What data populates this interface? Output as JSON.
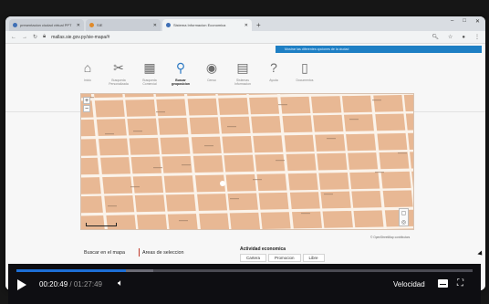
{
  "browser": {
    "tabs": [
      {
        "title": "presentacion ciudad virtual PPT"
      },
      {
        "title": "SIE"
      },
      {
        "title": "Sistema Informacion Economica"
      }
    ],
    "url": "mallas.sie.gov.py/sie-mapa/#"
  },
  "page": {
    "banner_text": "Mostrar las diferentes opciones de la ciudad"
  },
  "toolbar": {
    "items": [
      {
        "label": "Inicio",
        "icon": "home-icon",
        "active": false
      },
      {
        "label": "Busqueda Personalizada",
        "icon": "tools-icon",
        "active": false
      },
      {
        "label": "Busqueda Comercial",
        "icon": "store-icon",
        "active": false
      },
      {
        "label": "Buscar geoposicion",
        "icon": "locate-icon",
        "active": true
      },
      {
        "label": "Censo",
        "icon": "disc-icon",
        "active": false
      },
      {
        "label": "Sistemas Informacion",
        "icon": "calculator-icon",
        "active": false
      },
      {
        "label": "Ayuda",
        "icon": "help-icon",
        "active": false
      },
      {
        "label": "Documentos",
        "icon": "document-icon",
        "active": false
      }
    ]
  },
  "map": {
    "zoom_in": "+",
    "zoom_out": "−",
    "attribution": "© OpenStreetMap contributors"
  },
  "lower": {
    "search_prefix": "Buscar en el",
    "search_link": "mapa",
    "selection_link": "Areas de seleccion",
    "activity_title": "Actividad economica",
    "activity_tabs": [
      "Cartera",
      "Promocion",
      "Libre"
    ]
  },
  "player": {
    "current_time": "00:20:49",
    "duration": "01:27:49",
    "separator": "/",
    "speed_label": "Velocidad",
    "progress": 0.24
  },
  "colors": {
    "map_block": "#e8b894",
    "map_street": "#fbf3ea",
    "progress_fill": "#1d6fd6"
  }
}
